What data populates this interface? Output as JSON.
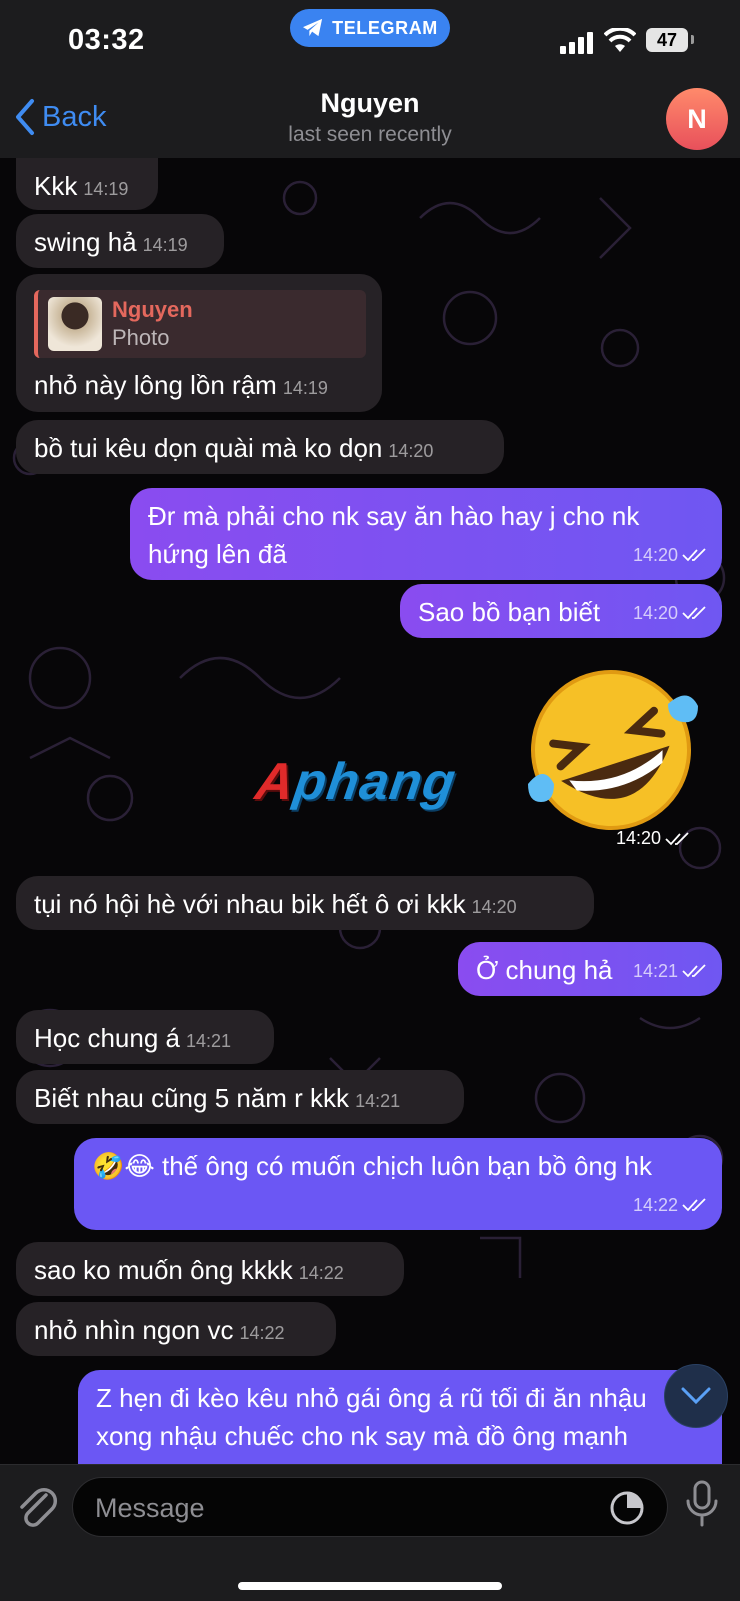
{
  "status_bar": {
    "time": "03:32",
    "app_pill": "TELEGRAM",
    "battery": "47"
  },
  "header": {
    "back_label": "Back",
    "name": "Nguyen",
    "status": "last seen recently",
    "avatar_letter": "N"
  },
  "messages": [
    {
      "side": "in",
      "text": "Kkk",
      "time": "14:19"
    },
    {
      "side": "in",
      "text": "swing hả",
      "time": "14:19"
    },
    {
      "side": "in",
      "reply_name": "Nguyen",
      "reply_text": "Photo",
      "text": "nhỏ này lông lồn rậm",
      "time": "14:19"
    },
    {
      "side": "in",
      "text": "bồ tui kêu dọn quài mà ko dọn",
      "time": "14:20"
    },
    {
      "side": "out",
      "text": "Đr mà phải cho nk say ăn hào hay j cho nk hứng lên đã",
      "time": "14:20"
    },
    {
      "side": "out",
      "text": "Sao bồ bạn biết",
      "time": "14:20"
    },
    {
      "side": "out",
      "sticker": "🤣",
      "time": "14:20"
    },
    {
      "side": "in",
      "text": "tụi nó hội hè với nhau bik hết ô ơi kkk",
      "time": "14:20"
    },
    {
      "side": "out",
      "text": "Ở chung hả",
      "time": "14:21"
    },
    {
      "side": "in",
      "text": "Học chung á",
      "time": "14:21"
    },
    {
      "side": "in",
      "text": "Biết nhau cũng 5 năm r kkk",
      "time": "14:21"
    },
    {
      "side": "out",
      "text": "🤣😂 thế ông có muốn chịch luôn bạn bồ ông hk",
      "time": "14:22"
    },
    {
      "side": "in",
      "text": "sao ko muốn ông kkkk",
      "time": "14:22"
    },
    {
      "side": "in",
      "text": "nhỏ nhìn ngon vc",
      "time": "14:22"
    },
    {
      "side": "out",
      "text": "Z hẹn đi kèo kêu nhỏ gái ông á rũ tối đi ăn nhậu xong nhậu chuếc cho nk say mà đồ ông mạnh"
    }
  ],
  "watermark": {
    "first": "A",
    "rest": "phang"
  },
  "input": {
    "placeholder": "Message"
  },
  "colors": {
    "accent": "#3f8cf2",
    "outgoing": "#7a52f2",
    "incoming": "#262226",
    "reply_name": "#e4685d"
  }
}
